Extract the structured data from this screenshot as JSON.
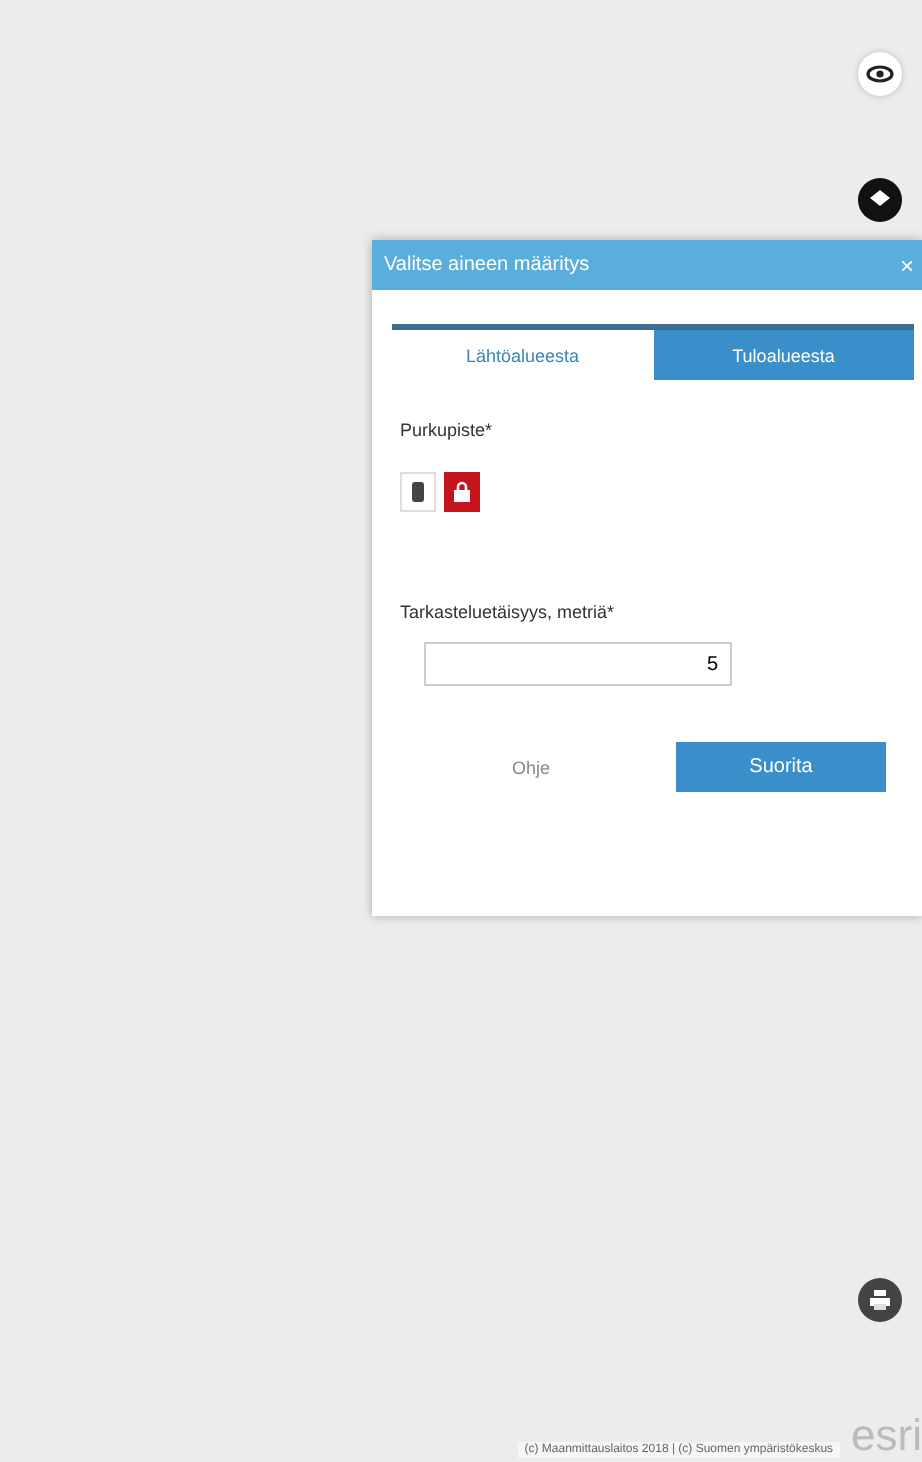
{
  "dialog": {
    "title": "Valitse aineen määritys",
    "close": "×",
    "tabs": [
      {
        "label": "Lähtöalueesta",
        "selected": true
      },
      {
        "label": "Tuloalueesta",
        "selected": false
      }
    ],
    "point_label": "Purkupiste*",
    "point_options": [
      {
        "kind": "device",
        "selected": false
      },
      {
        "kind": "lock",
        "selected": true
      }
    ],
    "distance_label": "Tarkasteluetäisyys, metriä*",
    "distance_value": "5",
    "help_link": "Ohje",
    "submit_button": "Suorita"
  },
  "attribution": "(c) Maanmittauslaitos 2018 | (c) Suomen ympäristökeskus",
  "logo": "esri"
}
